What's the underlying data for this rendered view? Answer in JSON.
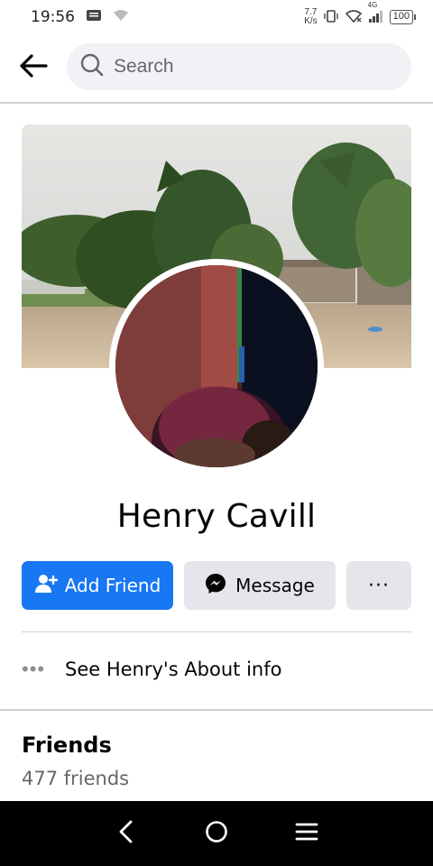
{
  "status_bar": {
    "time": "19:56",
    "net_speed_value": "7.7",
    "net_speed_unit": "K/s",
    "net_type": "4G",
    "battery": "100"
  },
  "search": {
    "placeholder": "Search"
  },
  "profile": {
    "name": "Henry Cavill"
  },
  "actions": {
    "add_friend": "Add Friend",
    "message": "Message",
    "more": "···"
  },
  "about": {
    "label": "See Henry's About info"
  },
  "friends": {
    "heading": "Friends",
    "count": "477 friends"
  },
  "colors": {
    "primary": "#1877f2",
    "secondary_button": "#e4e6eb",
    "search_bg": "#f0f2f5",
    "muted_text": "#65676b"
  },
  "icons": [
    "back-arrow-icon",
    "search-icon",
    "add-person-icon",
    "messenger-icon",
    "more-dots-icon",
    "nav-back-icon",
    "nav-home-icon",
    "nav-menu-icon"
  ]
}
